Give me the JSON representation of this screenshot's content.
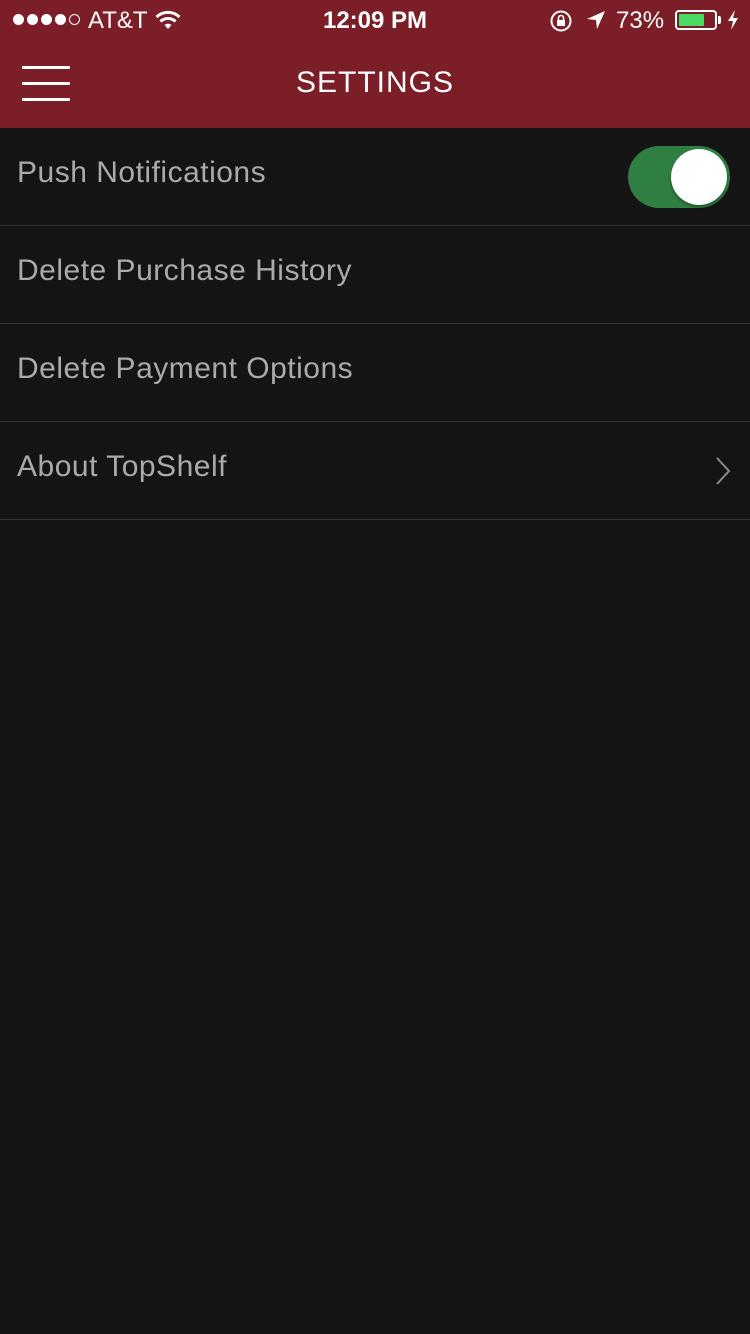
{
  "status_bar": {
    "carrier": "AT&T",
    "time": "12:09 PM",
    "battery_percent": "73%",
    "battery_level": 0.73,
    "signal_bars_filled": 4,
    "signal_bars_total": 5,
    "battery_color": "#4cd964"
  },
  "header": {
    "title": "SETTINGS",
    "background_color": "#7b1e27",
    "menu_icon": "hamburger-menu-icon"
  },
  "settings": {
    "items": [
      {
        "label": "Push Notifications",
        "control": "toggle",
        "toggle_on": true,
        "toggle_color": "#2e7f41"
      },
      {
        "label": "Delete Purchase History",
        "control": "none"
      },
      {
        "label": "Delete Payment Options",
        "control": "none"
      },
      {
        "label": "About TopShelf",
        "control": "chevron",
        "icon": "chevron-right-icon"
      }
    ]
  }
}
